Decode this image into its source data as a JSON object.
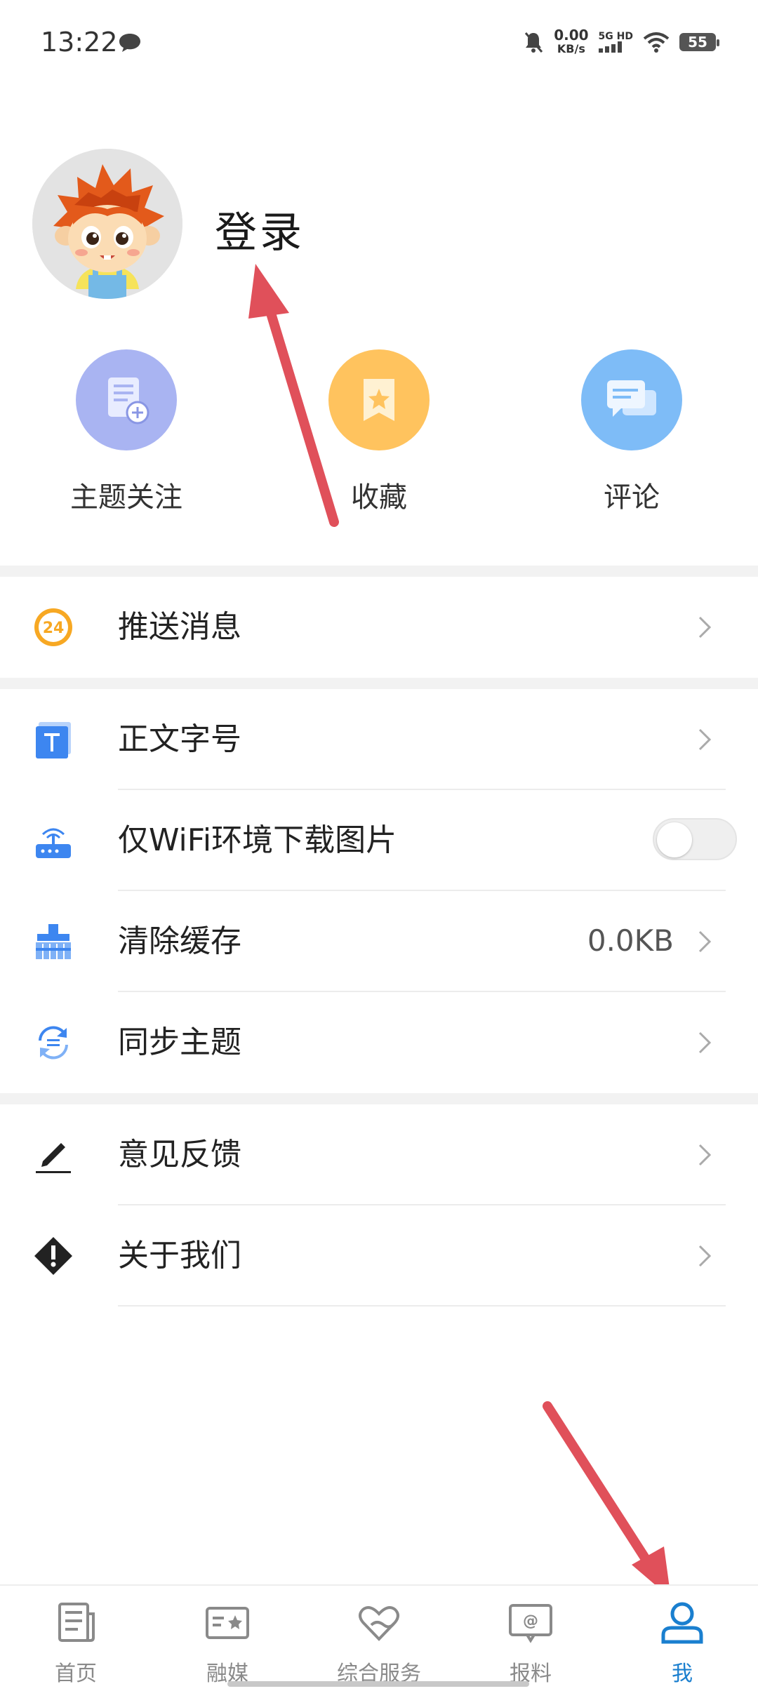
{
  "status_bar": {
    "time": "13:22",
    "net_speed": "0.00",
    "net_unit": "KB/s",
    "net_type": "5G HD",
    "battery": "55"
  },
  "profile": {
    "login_label": "登录"
  },
  "quick_actions": [
    {
      "label": "主题关注",
      "icon": "document-add-icon",
      "color": "#a9b4f2"
    },
    {
      "label": "收藏",
      "icon": "bookmark-star-icon",
      "color": "#ffc35e"
    },
    {
      "label": "评论",
      "icon": "chat-bubbles-icon",
      "color": "#7ebcf7"
    }
  ],
  "settings": {
    "push_messages": "推送消息",
    "font_size": "正文字号",
    "wifi_images": "仅WiFi环境下载图片",
    "clear_cache": "清除缓存",
    "cache_size": "0.0KB",
    "sync_theme": "同步主题",
    "feedback": "意见反馈",
    "about_us": "关于我们",
    "wifi_toggle_on": false
  },
  "push_badge": "24",
  "bottom_nav": [
    {
      "label": "首页",
      "icon": "newspaper-icon"
    },
    {
      "label": "融媒",
      "icon": "media-card-icon"
    },
    {
      "label": "综合服务",
      "icon": "heart-hands-icon"
    },
    {
      "label": "报料",
      "icon": "at-message-icon"
    },
    {
      "label": "我",
      "icon": "person-icon",
      "active": true
    }
  ],
  "colors": {
    "accent": "#1a7fcf",
    "annotation_arrow": "#e0505a"
  }
}
